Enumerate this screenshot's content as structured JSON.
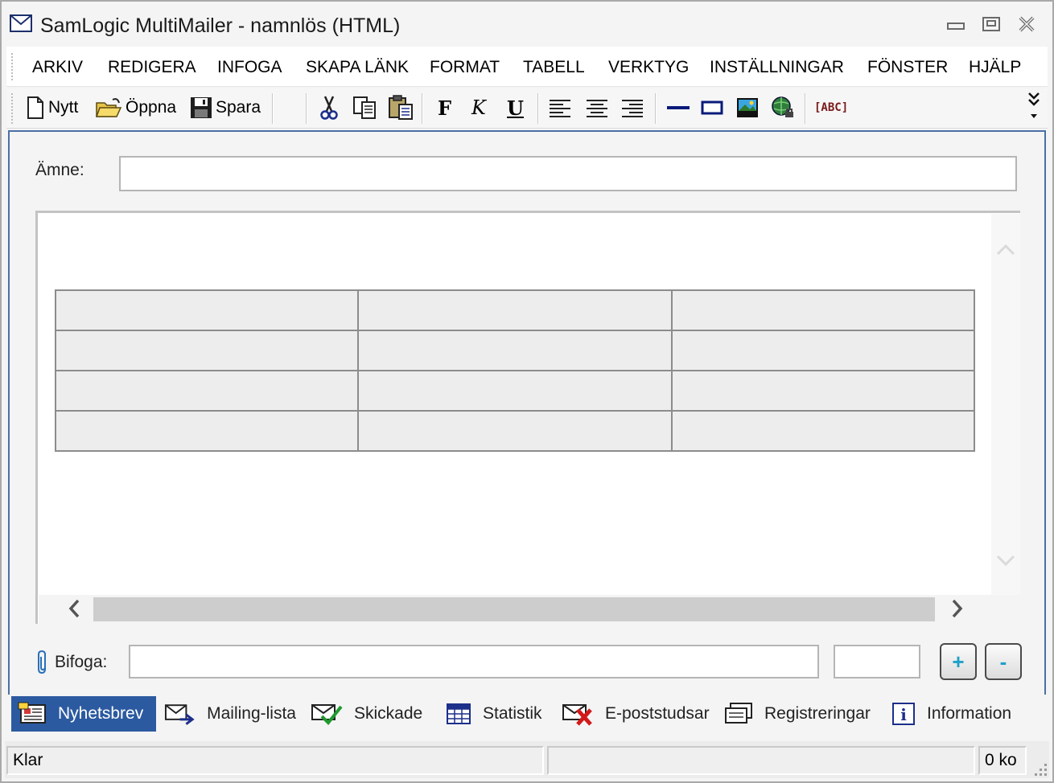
{
  "window": {
    "title": "SamLogic MultiMailer - namnlös  (HTML)",
    "icons": [
      "envelope-icon",
      "minimize-icon",
      "maximize-icon",
      "close-icon"
    ]
  },
  "menu": {
    "items": [
      "ARKIV",
      "REDIGERA",
      "INFOGA",
      "SKAPA LÄNK",
      "FORMAT",
      "TABELL",
      "VERKTYG",
      "INSTÄLLNINGAR",
      "FÖNSTER",
      "HJÄLP"
    ]
  },
  "toolbar": {
    "new_label": "Nytt",
    "open_label": "Öppna",
    "save_label": "Spara",
    "bold_glyph": "F",
    "italic_glyph": "K",
    "underline_glyph": "U",
    "spell_label": "[ABC]"
  },
  "subject": {
    "label": "Ämne:",
    "value": ""
  },
  "editor": {
    "table": [
      [
        "",
        "",
        ""
      ],
      [
        "",
        "",
        ""
      ],
      [
        "",
        "",
        ""
      ],
      [
        "",
        "",
        ""
      ]
    ]
  },
  "attachment": {
    "label": "Bifoga:",
    "value": "",
    "size": "",
    "add_label": "+",
    "remove_label": "-"
  },
  "tabs": [
    {
      "label": "Nyhetsbrev",
      "icon": "newsletter-icon",
      "active": true
    },
    {
      "label": "Mailing-lista",
      "icon": "mailing-list-icon",
      "active": false
    },
    {
      "label": "Skickade",
      "icon": "sent-icon",
      "active": false
    },
    {
      "label": "Statistik",
      "icon": "statistics-icon",
      "active": false
    },
    {
      "label": "E-poststudsar",
      "icon": "bounce-icon",
      "active": false
    },
    {
      "label": "Registreringar",
      "icon": "registrations-icon",
      "active": false
    },
    {
      "label": "Information",
      "icon": "information-icon",
      "active": false
    }
  ],
  "status": {
    "left": "Klar",
    "middle": "",
    "right": "0 ko"
  },
  "colors": {
    "accent": "#2c5aa0",
    "plus_minus": "#1fa0c8"
  }
}
